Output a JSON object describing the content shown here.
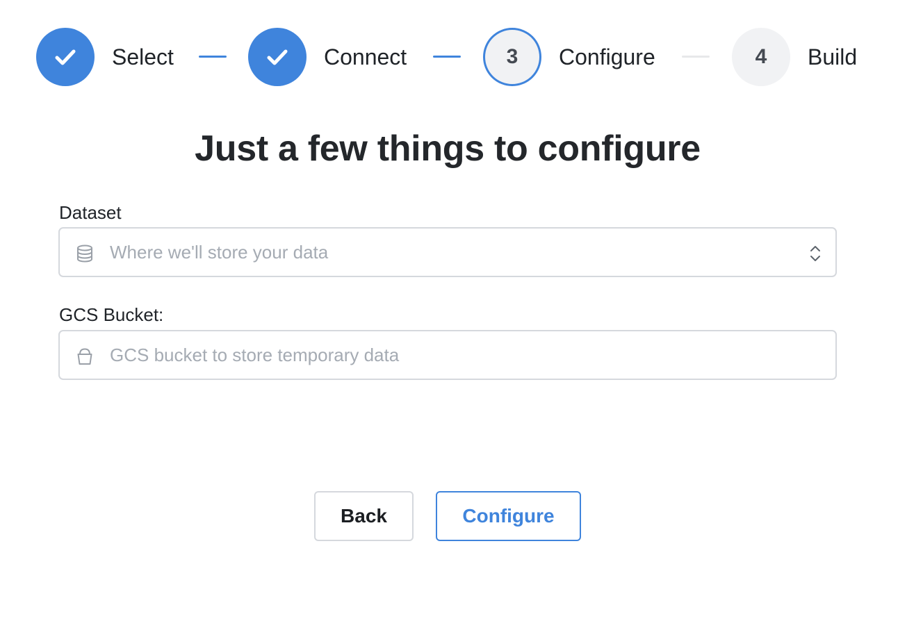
{
  "stepper": {
    "steps": [
      {
        "label": "Select",
        "state": "completed",
        "icon": "check-icon"
      },
      {
        "label": "Connect",
        "state": "completed",
        "icon": "check-icon"
      },
      {
        "label": "Configure",
        "state": "current",
        "number": "3"
      },
      {
        "label": "Build",
        "state": "pending",
        "number": "4"
      }
    ]
  },
  "heading": "Just a few things to configure",
  "form": {
    "dataset": {
      "label": "Dataset",
      "placeholder": "Where we'll store your data",
      "icon": "database-icon",
      "control": "select"
    },
    "gcs_bucket": {
      "label": "GCS Bucket:",
      "placeholder": "GCS bucket to store temporary data",
      "icon": "bucket-icon",
      "control": "text"
    }
  },
  "actions": {
    "back_label": "Back",
    "configure_label": "Configure"
  },
  "colors": {
    "accent": "#3f84dc",
    "step_pending_bg": "#f1f2f4",
    "border": "#d5d8dd",
    "placeholder": "#a5abb3"
  }
}
